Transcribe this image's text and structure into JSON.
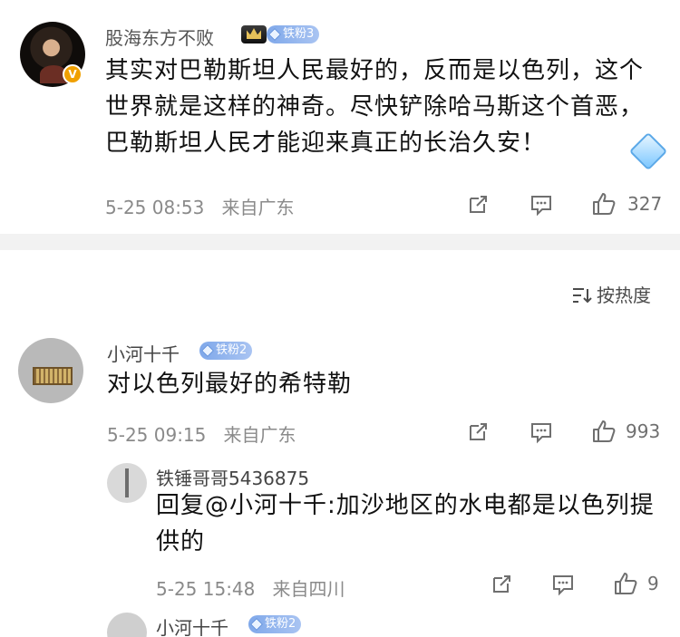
{
  "post": {
    "username": "股海东方不败",
    "badge": "铁粉3",
    "content": "其实对巴勒斯坦人民最好的，反而是以色列，这个世界就是这样的神奇。尽快铲除哈马斯这个首恶，巴勒斯坦人民才能迎来真正的长治久安！",
    "timestamp": "5-25 08:53",
    "location": "来自广东",
    "likes": "327",
    "verified_mark": "V"
  },
  "sort": {
    "label": "按热度"
  },
  "comments": [
    {
      "username": "小河十千",
      "badge": "铁粉2",
      "content": "对以色列最好的希特勒",
      "timestamp": "5-25 09:15",
      "location": "来自广东",
      "likes": "993"
    },
    {
      "username": "铁锤哥哥5436875",
      "content": "回复@小河十千:加沙地区的水电都是以色列提供的",
      "timestamp": "5-25 15:48",
      "location": "来自四川",
      "likes": "9"
    },
    {
      "username": "小河十千",
      "badge": "铁粉2"
    }
  ],
  "colors": {
    "badge_blue": "#8fb3ee",
    "divider": "#f2f2f2",
    "meta_gray": "#8a8a8a"
  },
  "icons": [
    "share-icon",
    "comment-icon",
    "like-icon",
    "sort-icon",
    "verified-icon",
    "crown-icon",
    "diamond-icon"
  ]
}
